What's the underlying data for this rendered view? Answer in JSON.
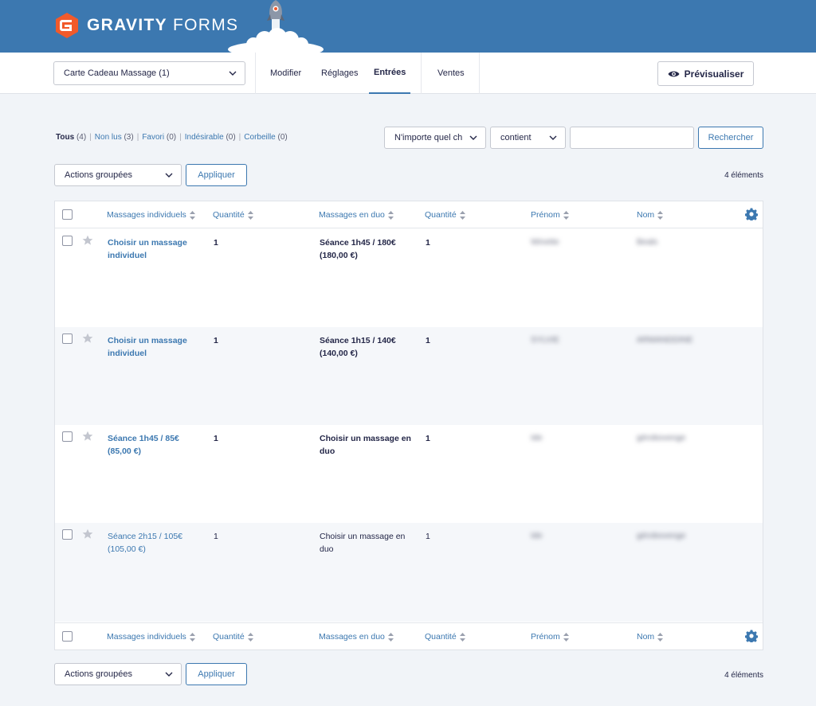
{
  "brand": {
    "name_bold": "GRAVITY",
    "name_light": "FORMS"
  },
  "toolbar": {
    "form_select": "Carte Cadeau Massage (1)",
    "nav": [
      "Modifier",
      "Réglages",
      "Entrées",
      "Ventes"
    ],
    "active_nav": "Entrées",
    "preview_label": "Prévisualiser"
  },
  "filters": {
    "all": "Tous",
    "all_count": "(4)",
    "unread": "Non lus",
    "unread_count": "(3)",
    "starred": "Favori",
    "starred_count": "(0)",
    "spam": "Indésirable",
    "spam_count": "(0)",
    "trash": "Corbeille",
    "trash_count": "(0)"
  },
  "search": {
    "field_select": "N'importe quel ch",
    "operator_select": "contient",
    "value": "",
    "button": "Rechercher"
  },
  "bulk": {
    "select": "Actions groupées",
    "apply": "Appliquer",
    "count": "4 éléments"
  },
  "columns": [
    "Massages individuels",
    "Quantité",
    "Massages en duo",
    "Quantité",
    "Prénom",
    "Nom"
  ],
  "rows": [
    {
      "col1": "Choisir un massage individuel",
      "q1": "1",
      "col2": "Séance 1h45 / 180€ (180,00 €)",
      "q2": "1",
      "prenom": "Winette",
      "nom": "Beals",
      "unread": true
    },
    {
      "col1": "Choisir un massage individuel",
      "q1": "1",
      "col2": "Séance 1h15 / 140€ (140,00 €)",
      "q2": "1",
      "prenom": "SYLVIE",
      "nom": "ARMANDDINE",
      "unread": true
    },
    {
      "col1": "Séance 1h45 / 85€ (85,00 €)",
      "q1": "1",
      "col2": "Choisir un massage en duo",
      "q2": "1",
      "prenom": "Ide",
      "nom": "gérobovenge",
      "unread": true
    },
    {
      "col1": "Séance 2h15 / 105€ (105,00 €)",
      "q1": "1",
      "col2": "Choisir un massage en duo",
      "q2": "1",
      "prenom": "Ide",
      "nom": "gérobovenge",
      "unread": false
    }
  ],
  "colors": {
    "brand_blue": "#3c78b0",
    "logo_orange": "#f15a2b",
    "text": "#242748"
  },
  "icons": [
    "gravity-forms-logo-icon",
    "rocket-icon",
    "chevron-down-icon",
    "eye-icon",
    "sort-icon",
    "star-icon",
    "gear-icon"
  ]
}
